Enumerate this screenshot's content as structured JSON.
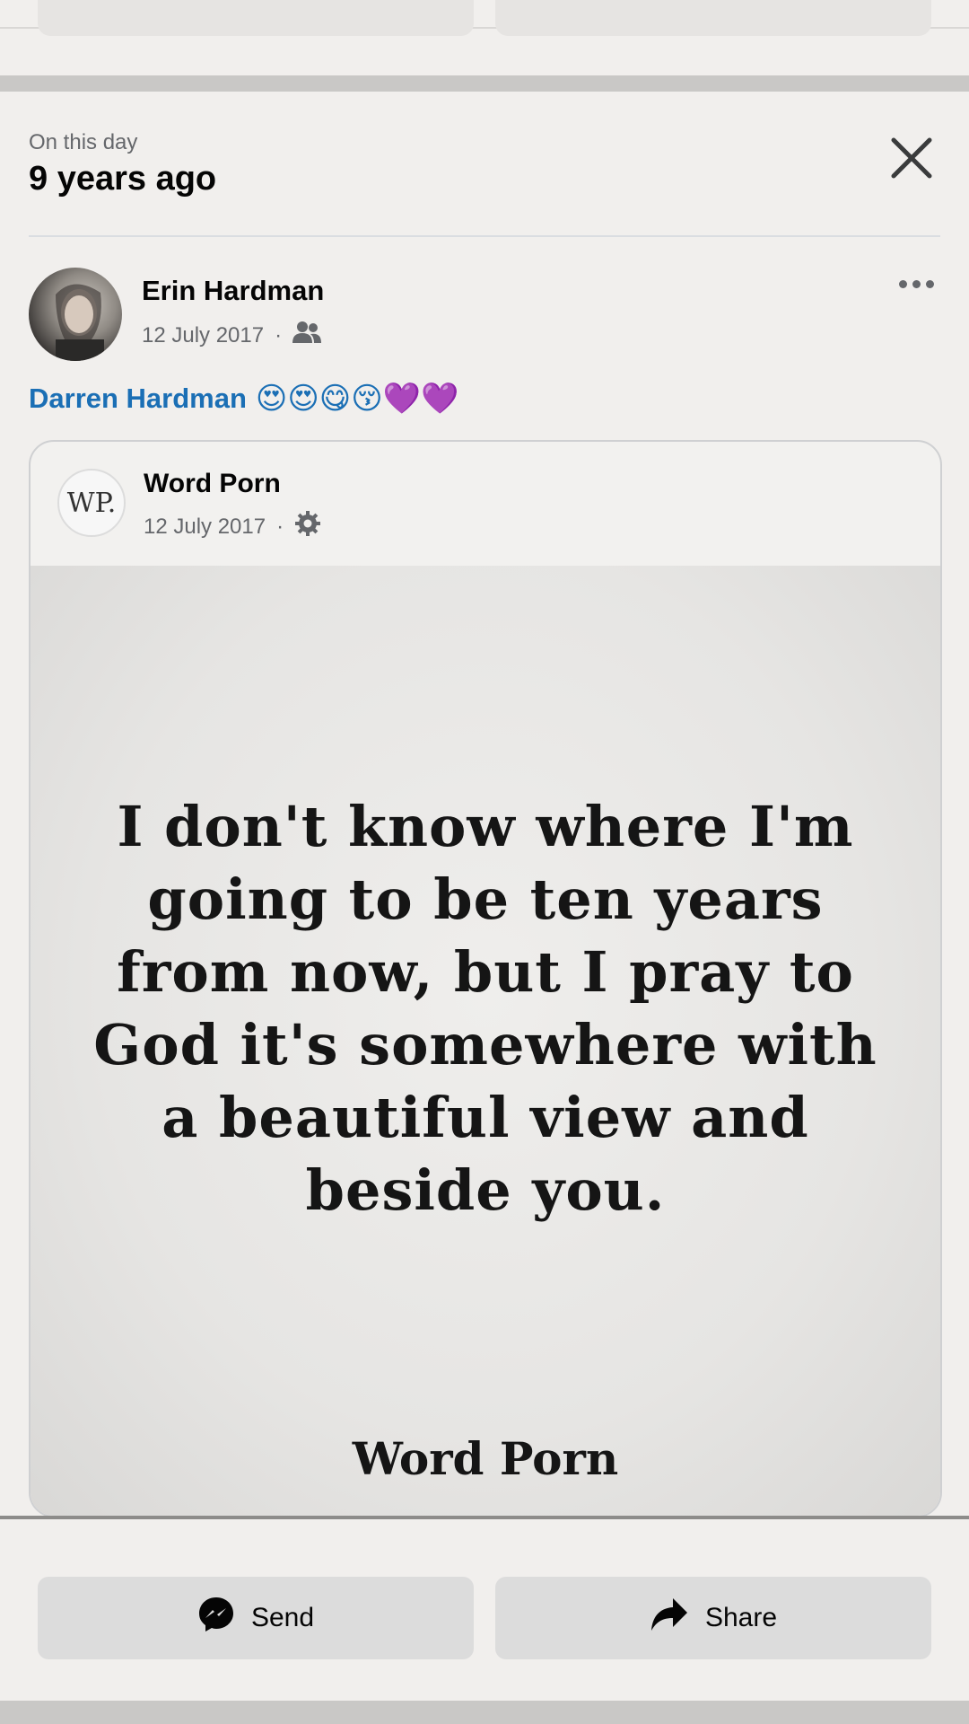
{
  "memory": {
    "label": "On this day",
    "years_ago": "9 years ago"
  },
  "post": {
    "author": "Erin Hardman",
    "date": "12 July 2017",
    "tagged": "Darren Hardman",
    "emojis": "😍😍😋😚💜💜"
  },
  "shared_post": {
    "page_name": "Word Porn",
    "page_logo_text": "WP.",
    "date": "12 July 2017",
    "quote_lines": [
      "I don't know where I'm",
      "going to be ten years",
      "from now, but I pray to",
      "God it's somewhere with",
      "a beautiful view and",
      "beside you."
    ],
    "signature": "Word Porn"
  },
  "actions": {
    "send": "Send",
    "share": "Share"
  },
  "icons": {
    "close": "close-icon",
    "more": "more-icon",
    "audience": "friends-icon",
    "settings": "settings-icon",
    "messenger": "messenger-icon",
    "share": "share-arrow-icon"
  },
  "colors": {
    "link_blue": "#1b6fb5",
    "background": "#f1efed",
    "button_bg": "#dcdcdc"
  }
}
